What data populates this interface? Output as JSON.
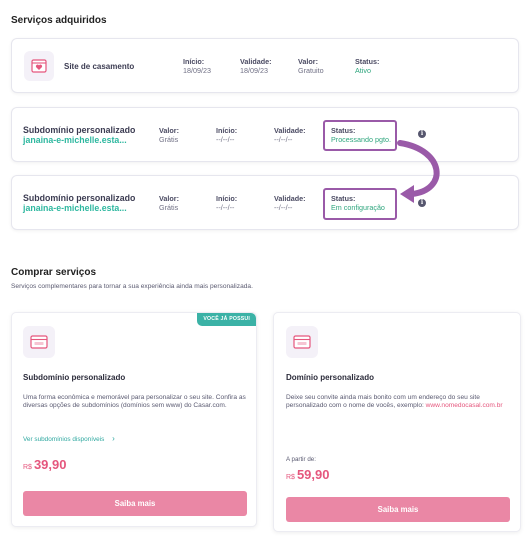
{
  "acquired": {
    "title": "Serviços adquiridos",
    "site": {
      "name": "Site de casamento",
      "cols": [
        {
          "label": "Início:",
          "value": "18/09/23"
        },
        {
          "label": "Validade:",
          "value": "18/09/23"
        },
        {
          "label": "Valor:",
          "value": "Gratuito"
        },
        {
          "label": "Status:",
          "value": "Ativo"
        }
      ]
    },
    "sub1": {
      "name": "Subdomínio personalizado",
      "link": "janaina-e-michelle.esta...",
      "cols": [
        {
          "label": "Valor:",
          "value": "Grátis"
        },
        {
          "label": "Início:",
          "value": "--/--/--"
        },
        {
          "label": "Validade:",
          "value": "--/--/--"
        },
        {
          "label": "Status:",
          "value": "Processando pgto."
        }
      ]
    },
    "sub2": {
      "name": "Subdomínio personalizado",
      "link": "janaina-e-michelle.esta...",
      "cols": [
        {
          "label": "Valor:",
          "value": "Grátis"
        },
        {
          "label": "Início:",
          "value": "--/--/--"
        },
        {
          "label": "Validade:",
          "value": "--/--/--"
        },
        {
          "label": "Status:",
          "value": "Em configuração"
        }
      ]
    },
    "info_glyph": "i"
  },
  "buy": {
    "title": "Comprar serviços",
    "subtitle": "Serviços complementares para tornar a sua experiência ainda mais personalizada.",
    "cards": [
      {
        "badge": "VOCÊ JÁ POSSUI",
        "title": "Subdomínio personalizado",
        "desc": "Uma forma econômica e memorável para personalizar o seu site. Confira as diversas opções de subdomínios (domínios sem www) do Casar.com.",
        "link": "Ver subdomínios disponíveis",
        "currency": "R$",
        "price": "39,90",
        "button": "Saiba mais"
      },
      {
        "title": "Domínio personalizado",
        "desc": "Deixe seu convite ainda mais bonito com um endereço do seu site personalizado com o nome de vocês, exemplo:",
        "desc_link": "www.nomedocasal.com.br",
        "price_label": "A partir de:",
        "currency": "R$",
        "price": "59,90",
        "button": "Saiba mais"
      }
    ]
  },
  "colors": {
    "accent_pink": "#ea87a5",
    "teal": "#3bb2a6",
    "highlight": "#9a5aa8",
    "status_green": "#2fa67e"
  },
  "icons": {
    "site": "heart-window-icon",
    "subdomain": "browser-window-icon",
    "arrow": "curved-arrow-icon"
  }
}
